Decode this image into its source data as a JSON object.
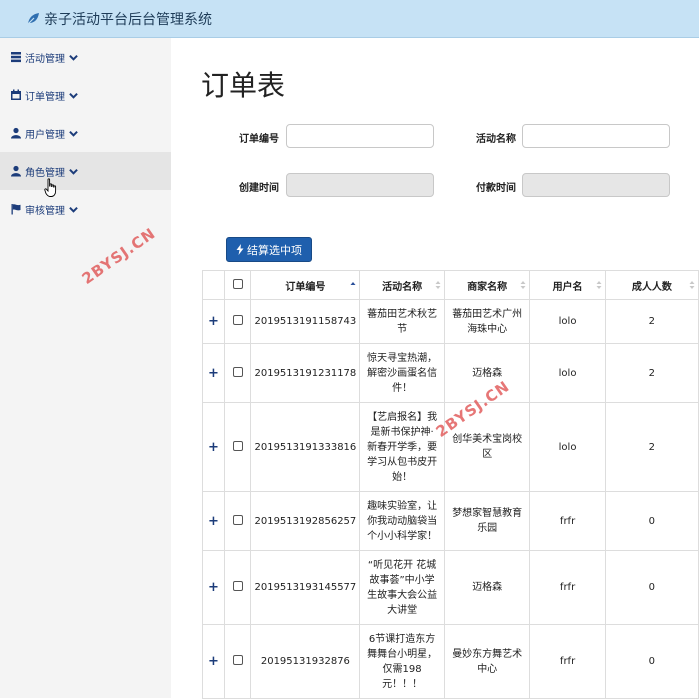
{
  "app": {
    "title": "亲子活动平台后台管理系统"
  },
  "sidebar": {
    "items": [
      {
        "label": "活动管理",
        "icon": "list-icon"
      },
      {
        "label": "订单管理",
        "icon": "calendar-icon"
      },
      {
        "label": "用户管理",
        "icon": "user-icon"
      },
      {
        "label": "角色管理",
        "icon": "user-icon"
      },
      {
        "label": "审核管理",
        "icon": "flag-icon"
      }
    ]
  },
  "page": {
    "title": "订单表"
  },
  "filters": {
    "order_no_label": "订单编号",
    "activity_name_label": "活动名称",
    "created_time_label": "创建时间",
    "paid_time_label": "付款时间"
  },
  "toolbar": {
    "settle_label": "结算选中项"
  },
  "table": {
    "headers": [
      "订单编号",
      "活动名称",
      "商家名称",
      "用户名",
      "成人人数"
    ],
    "rows": [
      {
        "order_no": "2019513191158743",
        "activity": [
          "蕃茄田艺术秋艺",
          "节"
        ],
        "merchant": [
          "蕃茄田艺术广州",
          "海珠中心"
        ],
        "user": "lolo",
        "adults": "2"
      },
      {
        "order_no": "2019513191231178",
        "activity": [
          "惊天寻宝热潮，",
          "解密沙画蛋名信",
          "件！"
        ],
        "merchant": [
          "迈格森"
        ],
        "user": "lolo",
        "adults": "2"
      },
      {
        "order_no": "2019513191333816",
        "activity": [
          "【艺启报名】我",
          "是新书保护神·",
          "新春开学季，要",
          "学习从包书皮开",
          "始！"
        ],
        "merchant": [
          "创华美术宝岗校",
          "区"
        ],
        "user": "lolo",
        "adults": "2"
      },
      {
        "order_no": "2019513192856257",
        "activity": [
          "趣味实验室，让",
          "你我动动脑袋当",
          "个小小科学家！"
        ],
        "merchant": [
          "梦想家智慧教育",
          "乐园"
        ],
        "user": "frfr",
        "adults": "0"
      },
      {
        "order_no": "2019513193145577",
        "activity": [
          "“听见花开 花城",
          "故事荟”中小学",
          "生故事大会公益",
          "大讲堂"
        ],
        "merchant": [
          "迈格森"
        ],
        "user": "frfr",
        "adults": "0"
      },
      {
        "order_no": "20195131932876",
        "activity": [
          "6节课打造东方",
          "舞舞台小明星，",
          "仅需198",
          "元！！！"
        ],
        "merchant": [
          "曼妙东方舞艺术",
          "中心"
        ],
        "user": "frfr",
        "adults": "0"
      }
    ]
  },
  "watermark": "2BYSJ.CN",
  "colors": {
    "topbar": "#c6e2f5",
    "sidebar": "#f4f4f4",
    "accent_button": "#1f5fad",
    "nav_text": "#1c3c7a",
    "watermark": "#e05555"
  }
}
